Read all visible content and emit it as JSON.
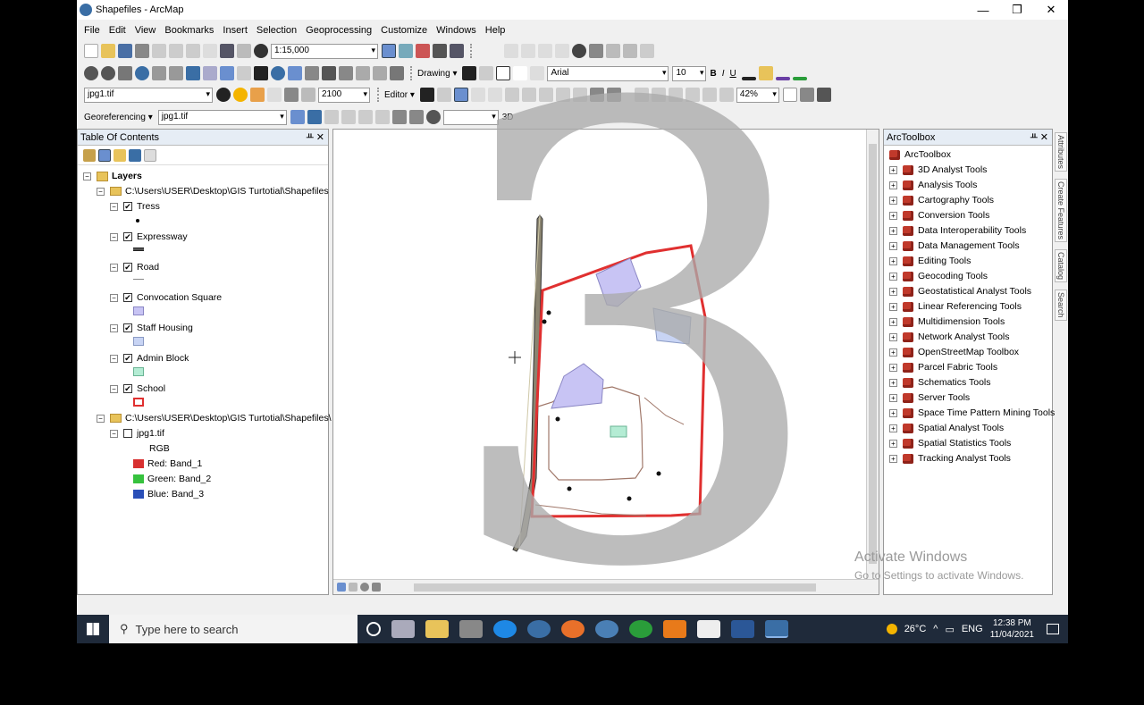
{
  "window": {
    "title": "Shapefiles - ArcMap",
    "minimize": "—",
    "maximize": "❐",
    "close": "✕"
  },
  "menu": [
    "File",
    "Edit",
    "View",
    "Bookmarks",
    "Insert",
    "Selection",
    "Geoprocessing",
    "Customize",
    "Windows",
    "Help"
  ],
  "toolbar": {
    "scale": "1:15,000",
    "drawing_label": "Drawing ▾",
    "font_name": "Arial",
    "font_size": "10",
    "bold": "B",
    "italic": "I",
    "underline": "U",
    "layer_select": "jpg1.tif",
    "zoom_value": "2100",
    "editor_label": "Editor ▾",
    "georef_label": "Georeferencing ▾",
    "georef_layer": "jpg1.tif",
    "percent": "42%",
    "threed_label": "3D"
  },
  "toc": {
    "title": "Table Of Contents",
    "root": "Layers",
    "folder1": "C:\\Users\\USER\\Desktop\\GIS Turtotial\\Shapefiles",
    "layers": [
      "Tress",
      "Expressway",
      "Road",
      "Convocation Square",
      "Staff Housing",
      "Admin Block",
      "School"
    ],
    "folder2": "C:\\Users\\USER\\Desktop\\GIS Turtotial\\Shapefiles\\",
    "raster": "jpg1.tif",
    "rgb": "RGB",
    "bands": [
      {
        "label": "Red:   Band_1",
        "color": "#d83030"
      },
      {
        "label": "Green: Band_2",
        "color": "#36c23e"
      },
      {
        "label": "Blue:   Band_3",
        "color": "#2a4fb8"
      }
    ]
  },
  "arctoolbox": {
    "title": "ArcToolbox",
    "root": "ArcToolbox",
    "tools": [
      "3D Analyst Tools",
      "Analysis Tools",
      "Cartography Tools",
      "Conversion Tools",
      "Data Interoperability Tools",
      "Data Management Tools",
      "Editing Tools",
      "Geocoding Tools",
      "Geostatistical Analyst Tools",
      "Linear Referencing Tools",
      "Multidimension Tools",
      "Network Analyst Tools",
      "OpenStreetMap Toolbox",
      "Parcel Fabric Tools",
      "Schematics Tools",
      "Server Tools",
      "Space Time Pattern Mining Tools",
      "Spatial Analyst Tools",
      "Spatial Statistics Tools",
      "Tracking Analyst Tools"
    ]
  },
  "side_tabs": [
    "Attributes",
    "Create Features",
    "Catalog",
    "Search"
  ],
  "watermark": {
    "line1": "Activate Windows",
    "line2": "Go to Settings to activate Windows."
  },
  "overlay_digit": "3",
  "taskbar": {
    "search_placeholder": "Type here to search",
    "weather": "26°C",
    "lang": "ENG",
    "time": "12:38 PM",
    "date": "11/04/2021"
  },
  "colors": {
    "boundary": "#e03030",
    "polygon_fill": "#c8c4f4",
    "admin_fill": "#b4ecd4",
    "road": "#a0786a"
  }
}
